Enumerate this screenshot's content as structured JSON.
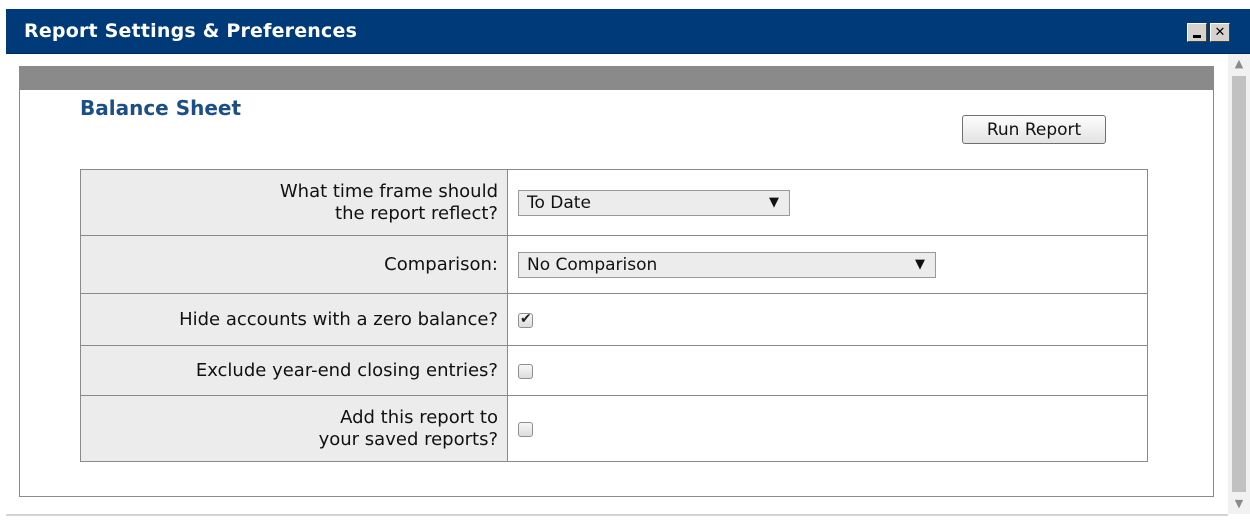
{
  "window": {
    "title": "Report Settings & Preferences",
    "minimize_glyph": "",
    "close_glyph": "✕"
  },
  "panel": {
    "title": "Balance Sheet",
    "run_button_label": "Run Report"
  },
  "settings": {
    "time_frame": {
      "label_line1": "What time frame should",
      "label_line2": "the report reflect?",
      "selected": "To Date"
    },
    "comparison": {
      "label": "Comparison:",
      "selected": "No Comparison"
    },
    "hide_zero": {
      "label": "Hide accounts with a zero balance?",
      "checked": true
    },
    "exclude_closing": {
      "label": "Exclude year-end closing entries?",
      "checked": false
    },
    "add_saved": {
      "label_line1": "Add this report to",
      "label_line2": "your saved reports?",
      "checked": false
    }
  },
  "icons": {
    "dropdown": "chevron-down-icon",
    "check": "checkmark-icon",
    "scroll_up": "scroll-up-arrow-icon",
    "scroll_down": "scroll-down-arrow-icon"
  },
  "colors": {
    "titlebar": "#003a79",
    "section_title": "#1b4f86",
    "panel_header": "#8a8a8a",
    "label_cell_bg": "#ececec"
  }
}
